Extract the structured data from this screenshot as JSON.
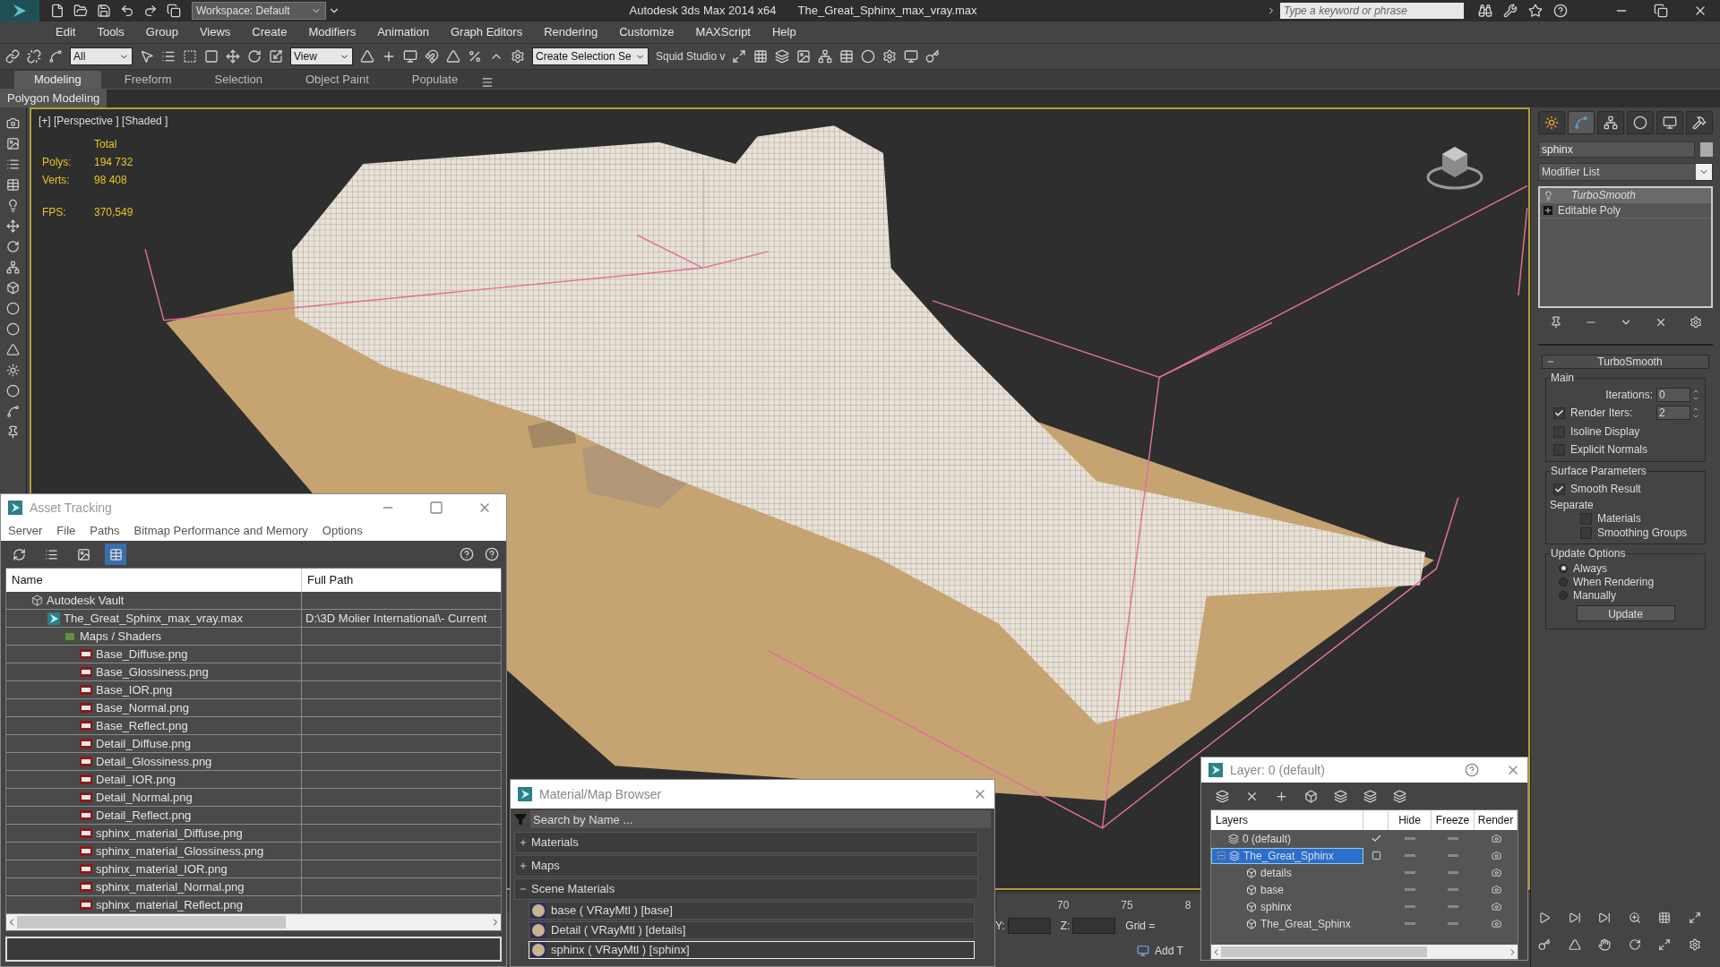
{
  "title_bar": {
    "workspace": "Workspace: Default",
    "app_title": "Autodesk 3ds Max  2014 x64",
    "file_name": "The_Great_Sphinx_max_vray.max",
    "search_placeholder": "Type a keyword or phrase"
  },
  "menu": [
    "Edit",
    "Tools",
    "Group",
    "Views",
    "Create",
    "Modifiers",
    "Animation",
    "Graph Editors",
    "Rendering",
    "Customize",
    "MAXScript",
    "Help"
  ],
  "toolbar": {
    "selection_filter": "All",
    "reference_coord": "View",
    "named_selection": "Create Selection Se",
    "plugin_label": "Squid Studio v"
  },
  "ribbon": {
    "tabs": [
      {
        "label": "Modeling",
        "selected": true
      },
      {
        "label": "Freeform",
        "selected": false
      },
      {
        "label": "Selection",
        "selected": false
      },
      {
        "label": "Object Paint",
        "selected": false
      },
      {
        "label": "Populate",
        "selected": false
      }
    ],
    "panel_label": "Polygon Modeling"
  },
  "viewport": {
    "label": "[+] [Perspective ] [Shaded ]",
    "stats_header": "Total",
    "stats": [
      {
        "label": "Polys:",
        "value": "194 732"
      },
      {
        "label": "Verts:",
        "value": "98 408"
      }
    ],
    "fps_label": "FPS:",
    "fps_value": "370,549"
  },
  "command_panel": {
    "tabs": [
      {
        "kind": "create",
        "selected": false
      },
      {
        "kind": "modify",
        "selected": true
      },
      {
        "kind": "hierarchy",
        "selected": false
      },
      {
        "kind": "motion",
        "selected": false
      },
      {
        "kind": "display",
        "selected": false
      },
      {
        "kind": "utilities",
        "selected": false
      }
    ],
    "object_name": "sphinx",
    "modifier_list": "Modifier List",
    "stack": [
      {
        "label": "TurboSmooth",
        "kind": "modifier",
        "selected": true
      },
      {
        "label": "Editable Poly",
        "kind": "base",
        "selected": false
      }
    ],
    "rollout_title": "TurboSmooth",
    "groups": [
      {
        "title": "Main",
        "items": [
          {
            "kind": "spinner",
            "label": "Iterations:",
            "value": "0"
          },
          {
            "kind": "check_spinner",
            "label": "Render Iters:",
            "checked": true,
            "value": "2"
          },
          {
            "kind": "checkbox",
            "label": "Isoline Display",
            "checked": false
          },
          {
            "kind": "checkbox",
            "label": "Explicit Normals",
            "checked": false
          }
        ]
      },
      {
        "title": "Surface Parameters",
        "items": [
          {
            "kind": "checkbox",
            "label": "Smooth Result",
            "checked": true
          },
          {
            "kind": "label",
            "label": "Separate"
          },
          {
            "kind": "sub_checkbox",
            "label": "Materials",
            "checked": false
          },
          {
            "kind": "sub_checkbox",
            "label": "Smoothing Groups",
            "checked": false
          }
        ]
      },
      {
        "title": "Update Options",
        "items": [
          {
            "kind": "radio",
            "label": "Always",
            "selected": true
          },
          {
            "kind": "radio",
            "label": "When Rendering",
            "selected": false
          },
          {
            "kind": "radio",
            "label": "Manually",
            "selected": false
          },
          {
            "kind": "button",
            "label": "Update"
          }
        ]
      }
    ]
  },
  "asset_tracking": {
    "title": "Asset Tracking",
    "menu": [
      "Server",
      "File",
      "Paths",
      "Bitmap Performance and Memory",
      "Options"
    ],
    "view_buttons": [
      {
        "kind": "refresh",
        "selected": false
      },
      {
        "kind": "list",
        "selected": false
      },
      {
        "kind": "thumbnail",
        "selected": false
      },
      {
        "kind": "table",
        "selected": true
      }
    ],
    "columns": [
      "Name",
      "Full Path"
    ],
    "tree": [
      {
        "kind": "vault",
        "name": "Autodesk Vault",
        "children": [
          {
            "kind": "scene",
            "name": "The_Great_Sphinx_max_vray.max",
            "path": "D:\\3D Molier International\\- Current",
            "children": [
              {
                "kind": "folder",
                "name": "Maps / Shaders",
                "children": [
                  {
                    "kind": "png",
                    "name": "Base_Diffuse.png"
                  },
                  {
                    "kind": "png",
                    "name": "Base_Glossiness.png"
                  },
                  {
                    "kind": "png",
                    "name": "Base_IOR.png"
                  },
                  {
                    "kind": "png",
                    "name": "Base_Normal.png"
                  },
                  {
                    "kind": "png",
                    "name": "Base_Reflect.png"
                  },
                  {
                    "kind": "png",
                    "name": "Detail_Diffuse.png"
                  },
                  {
                    "kind": "png",
                    "name": "Detail_Glossiness.png"
                  },
                  {
                    "kind": "png",
                    "name": "Detail_IOR.png"
                  },
                  {
                    "kind": "png",
                    "name": "Detail_Normal.png"
                  },
                  {
                    "kind": "png",
                    "name": "Detail_Reflect.png"
                  },
                  {
                    "kind": "png",
                    "name": "sphinx_material_Diffuse.png"
                  },
                  {
                    "kind": "png",
                    "name": "sphinx_material_Glossiness.png"
                  },
                  {
                    "kind": "png",
                    "name": "sphinx_material_IOR.png"
                  },
                  {
                    "kind": "png",
                    "name": "sphinx_material_Normal.png"
                  },
                  {
                    "kind": "png",
                    "name": "sphinx_material_Reflect.png"
                  }
                ]
              }
            ]
          }
        ]
      }
    ]
  },
  "material_browser": {
    "title": "Material/Map Browser",
    "search_placeholder": "Search by Name ...",
    "groups": [
      {
        "label": "Materials",
        "expanded": false
      },
      {
        "label": "Maps",
        "expanded": false
      },
      {
        "label": "Scene Materials",
        "expanded": true,
        "items": [
          {
            "label": "base ( VRayMtl ) [base]",
            "selected": false
          },
          {
            "label": "Detail ( VRayMtl ) [details]",
            "selected": false
          },
          {
            "label": "sphinx ( VRayMtl ) [sphinx]",
            "selected": true
          }
        ]
      }
    ]
  },
  "layer_dialog": {
    "title": "Layer: 0 (default)",
    "columns": [
      "Layers",
      "Hide",
      "Freeze",
      "Render"
    ],
    "layers": [
      {
        "kind": "layer",
        "label": "0 (default)",
        "current": true,
        "selected": false
      },
      {
        "kind": "layer",
        "label": "The_Great_Sphinx",
        "current": false,
        "selected": true,
        "expanded": true,
        "children": [
          {
            "kind": "object",
            "label": "details"
          },
          {
            "kind": "object",
            "label": "base"
          },
          {
            "kind": "object",
            "label": "sphinx"
          },
          {
            "kind": "object",
            "label": "The_Great_Sphinx"
          }
        ]
      }
    ]
  },
  "timeline": {
    "ticks": [
      "70",
      "75",
      "8"
    ]
  },
  "status_bar": {
    "y_label": "Y:",
    "z_label": "Z:",
    "grid_label": "Grid =",
    "add_time_tag": "Add T"
  }
}
